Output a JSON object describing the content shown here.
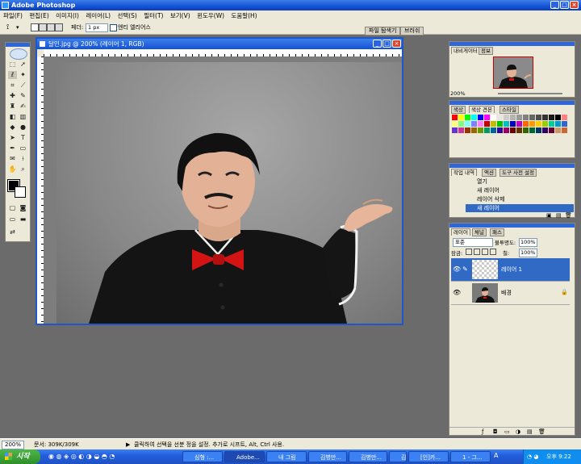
{
  "app": {
    "title": "Adobe Photoshop",
    "window_controls": {
      "minimize": "_",
      "maximize": "□",
      "close": "×"
    }
  },
  "menu": [
    "파일(F)",
    "편집(E)",
    "이미지(I)",
    "레이어(L)",
    "선택(S)",
    "필터(T)",
    "보기(V)",
    "윈도우(W)",
    "도움말(H)"
  ],
  "options_bar": {
    "feather_label": "페더:",
    "feather_value": "1 px",
    "antialias_label": "엔티 엘리어스",
    "tabs": [
      "파일 탐색기",
      "브러쉬"
    ]
  },
  "document": {
    "title": "달인.jpg @ 200% (레이어 1, RGB)"
  },
  "navigator": {
    "tabs": [
      "내비게이터",
      "정보"
    ],
    "zoom": "200%"
  },
  "swatches": {
    "tabs": [
      "색상",
      "색상 견본",
      "스타일"
    ],
    "colors": [
      "#ff0000",
      "#ffff00",
      "#00ff00",
      "#00ffff",
      "#0000ff",
      "#ff00ff",
      "#ffffff",
      "#e6e6e6",
      "#cccccc",
      "#b3b3b3",
      "#999999",
      "#808080",
      "#666666",
      "#4d4d4d",
      "#333333",
      "#1a1a1a",
      "#000000",
      "#ff8080",
      "#ffff80",
      "#80ff80",
      "#80ffff",
      "#8080ff",
      "#ff80ff",
      "#c00000",
      "#c0c000",
      "#00c000",
      "#00c0c0",
      "#0000c0",
      "#c000c0",
      "#ff6600",
      "#ff9900",
      "#ffcc00",
      "#99cc00",
      "#00cc99",
      "#0099cc",
      "#3366cc",
      "#6633cc",
      "#cc3399",
      "#993300",
      "#996600",
      "#669900",
      "#009966",
      "#006699",
      "#330099",
      "#990066",
      "#660000",
      "#663300",
      "#336600",
      "#006633",
      "#003366",
      "#330066",
      "#660033",
      "#cc9966",
      "#cc6633"
    ]
  },
  "history": {
    "tabs": [
      "작업 내역",
      "액션",
      "도구 사전 설정"
    ],
    "items": [
      "열기",
      "새 레이어",
      "레이어 삭제",
      "새 레이어"
    ]
  },
  "layers": {
    "tabs": [
      "레이어",
      "채널",
      "패스"
    ],
    "blend_mode": "표준",
    "opacity_label": "불투명도:",
    "opacity": "100%",
    "lock_label": "잠금:",
    "fill_label": "칠:",
    "fill": "100%",
    "items": [
      "레이어 1",
      "배경"
    ]
  },
  "status": {
    "zoom": "200%",
    "doc": "문서: 309K/309K",
    "hint": "클릭하여 선택을 선분 정을 설정. 추가로 시프트, Alt, Ctrl 사용."
  },
  "taskbar": {
    "start": "시작",
    "tasks": [
      "심형 :...",
      "Adobe...",
      "내 그림",
      "김병만...",
      "김병만...",
      "김병만...",
      "[인]카...",
      "1 - 그..."
    ],
    "clock": "오후 9:22",
    "ime": "A"
  },
  "colors": {
    "accent": "#316ac5",
    "titlebar": "#1452d6",
    "chrome": "#ece9d8",
    "bowtie": "#d41414"
  }
}
